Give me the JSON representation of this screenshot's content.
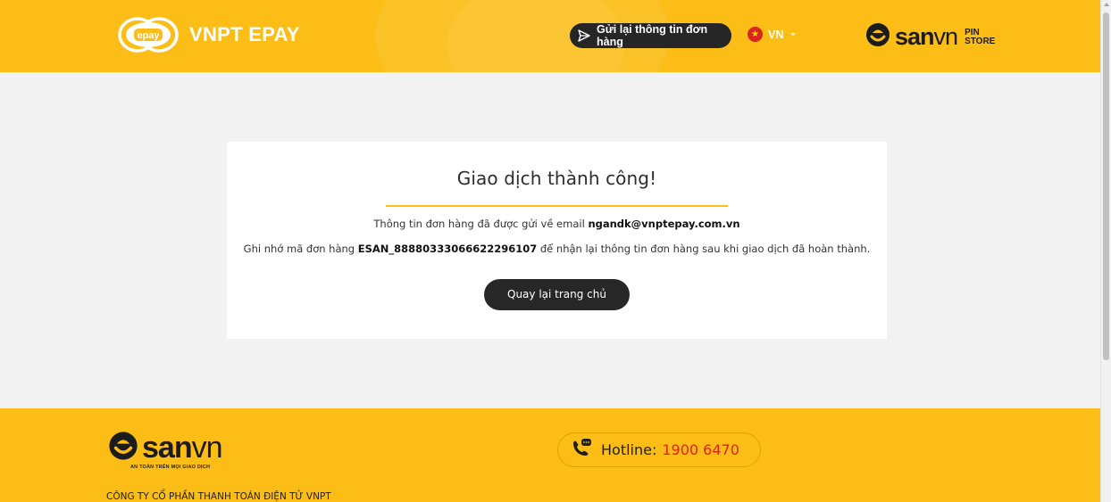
{
  "header": {
    "brand_name": "VNPT EPAY",
    "epay_logo_text": "epay",
    "resend_label": "Gửi lại thông tin đơn hàng",
    "language": "VN",
    "sanvn_brand": "san",
    "sanvn_suffix": "vn",
    "pin_store_line1": "PIN",
    "pin_store_line2": "STORE"
  },
  "result": {
    "title": "Giao dịch thành công!",
    "email_prefix": "Thông tin đơn hàng đã được gửi về email ",
    "email": "ngandk@vnptepay.com.vn",
    "order_prefix": "Ghi nhớ mã đơn hàng ",
    "order_code": "ESAN_88880333066622296107",
    "order_suffix": " để nhận lại thông tin đơn hàng sau khi giao dịch đã hoàn thành.",
    "home_button": "Quay lại trang chủ"
  },
  "footer": {
    "logo_brand": "san",
    "logo_suffix": "vn",
    "tagline": "AN TOÀN TRÊN MỌI GIAO DỊCH",
    "company": "CÔNG TY CỔ PHẦN THANH TOÁN ĐIỆN TỬ VNPT",
    "hotline_label": "Hotline:",
    "hotline_number": "1900 6470"
  },
  "colors": {
    "brand_yellow": "#fbbd16",
    "dark": "#262626",
    "hotline_red": "#e0201b"
  },
  "icons": [
    "epay-logo-icon",
    "send-icon",
    "vietnam-flag-icon",
    "chevron-down-icon",
    "sanvn-logo-icon",
    "phone-chat-icon"
  ]
}
